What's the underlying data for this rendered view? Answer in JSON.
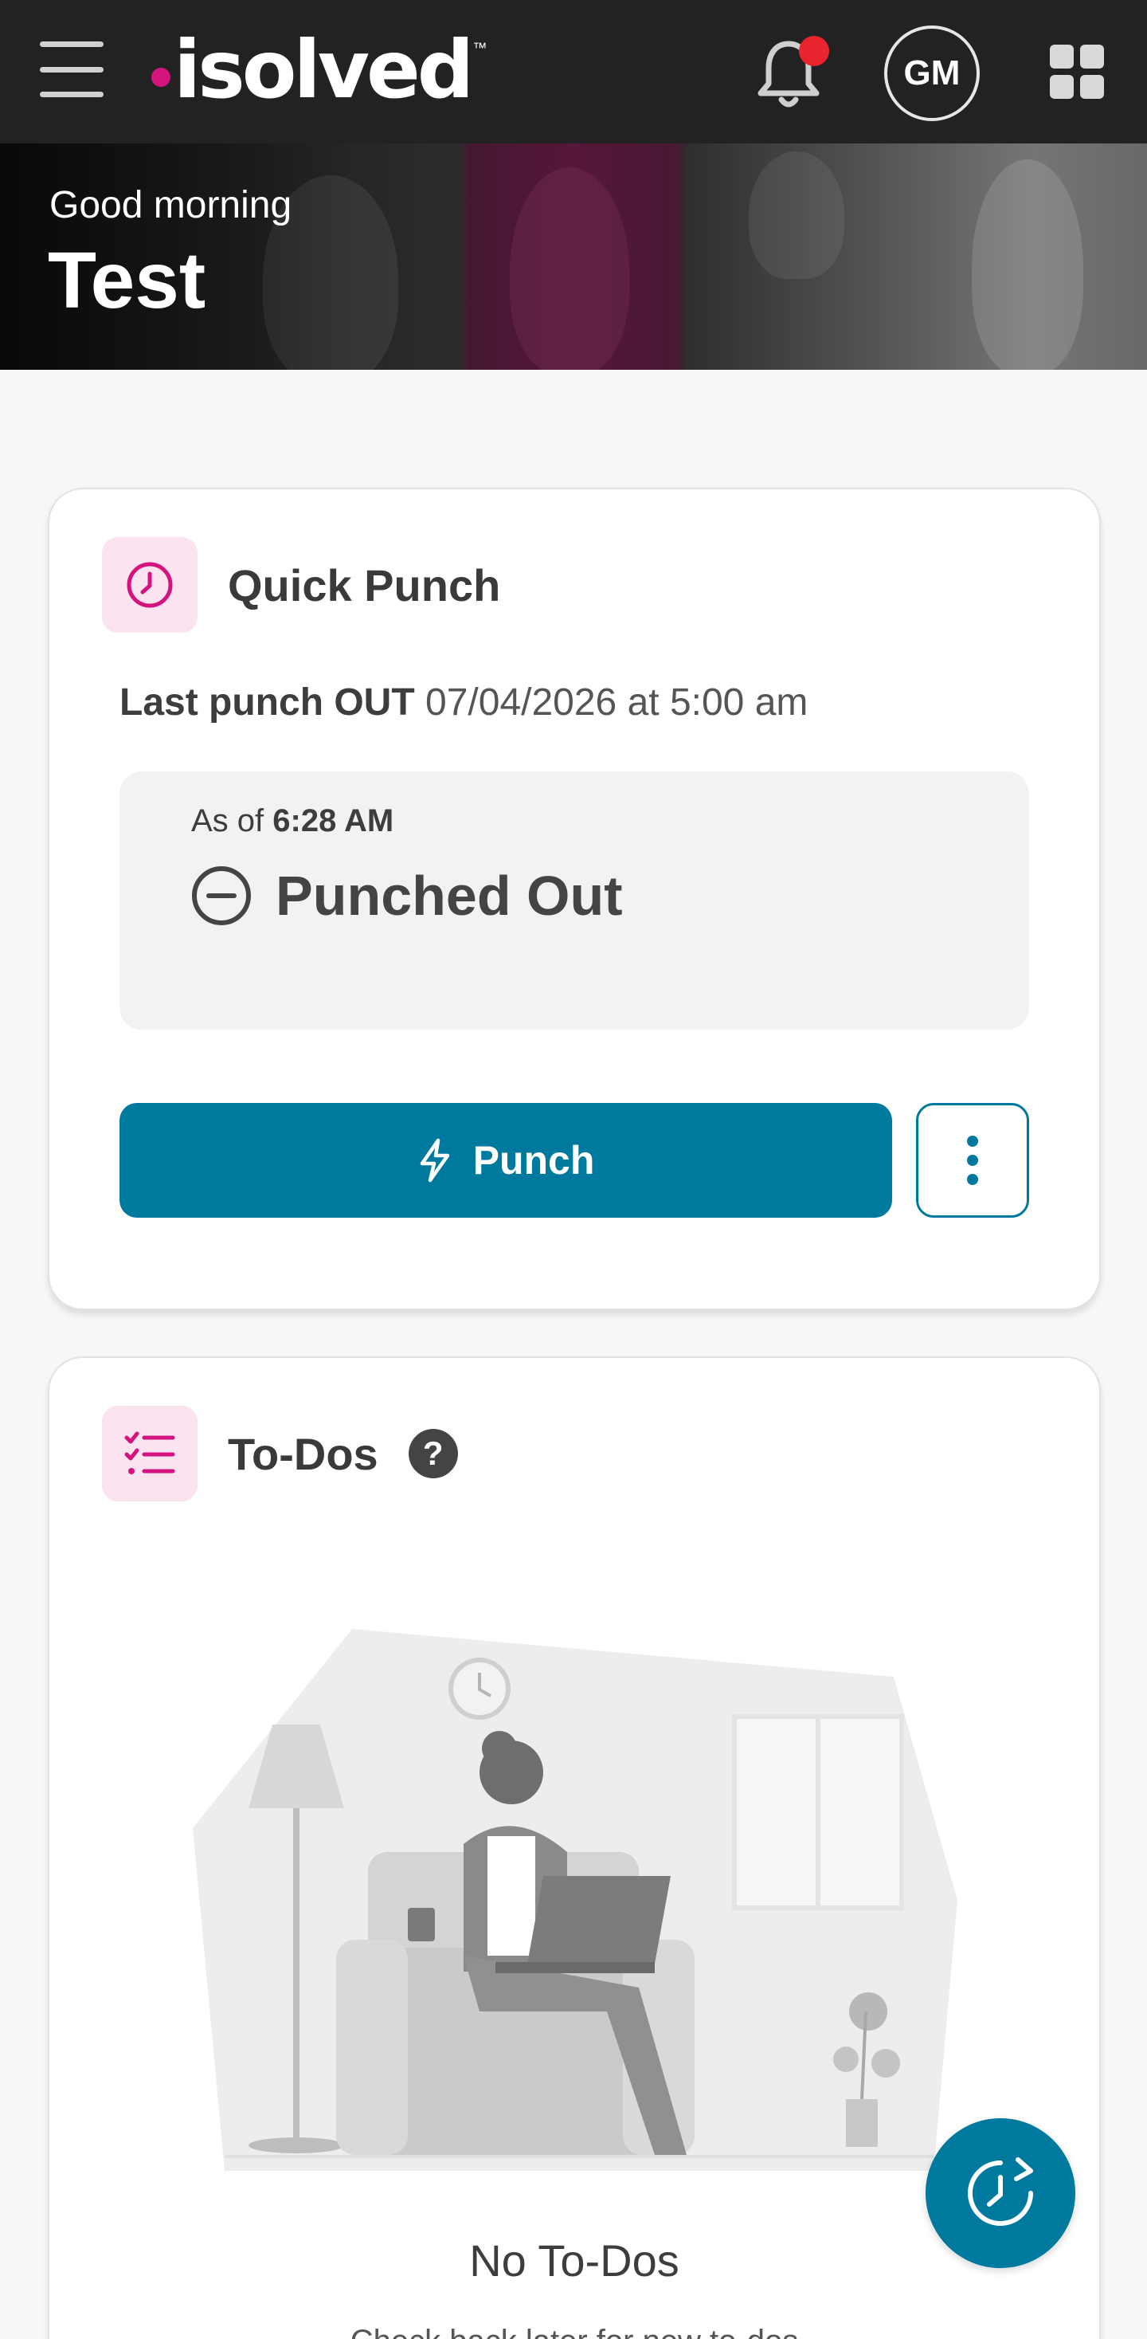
{
  "header": {
    "menu_icon": "hamburger-menu-icon",
    "logo_text": "isolved",
    "logo_tm": "™",
    "notification_icon": "bell-icon",
    "has_unread_notifications": true,
    "avatar_initials": "GM",
    "apps_icon": "grid-apps-icon"
  },
  "hero": {
    "greeting": "Good morning",
    "name": "Test"
  },
  "quick_punch": {
    "title": "Quick Punch",
    "icon": "clock-icon",
    "last_punch_label": "Last punch OUT",
    "last_punch_value": "07/04/2026 at 5:00 am",
    "as_of_label": "As of",
    "as_of_time": "6:28 AM",
    "status_icon": "minus-circle-icon",
    "status": "Punched Out",
    "punch_button_label": "Punch",
    "punch_button_icon": "lightning-bolt-icon",
    "more_icon": "vertical-ellipsis-icon"
  },
  "todos": {
    "title": "To-Dos",
    "icon": "checklist-icon",
    "help_label": "?",
    "empty_title": "No To-Dos",
    "empty_subtitle": "Check back later for new to-dos"
  },
  "fab": {
    "icon": "refresh-clock-icon"
  },
  "colors": {
    "topbar": "#222222",
    "brand_pink": "#d5137f",
    "primary": "#00799e",
    "icon_bg": "#fbe3ef",
    "notification_dot": "#e8242e"
  }
}
